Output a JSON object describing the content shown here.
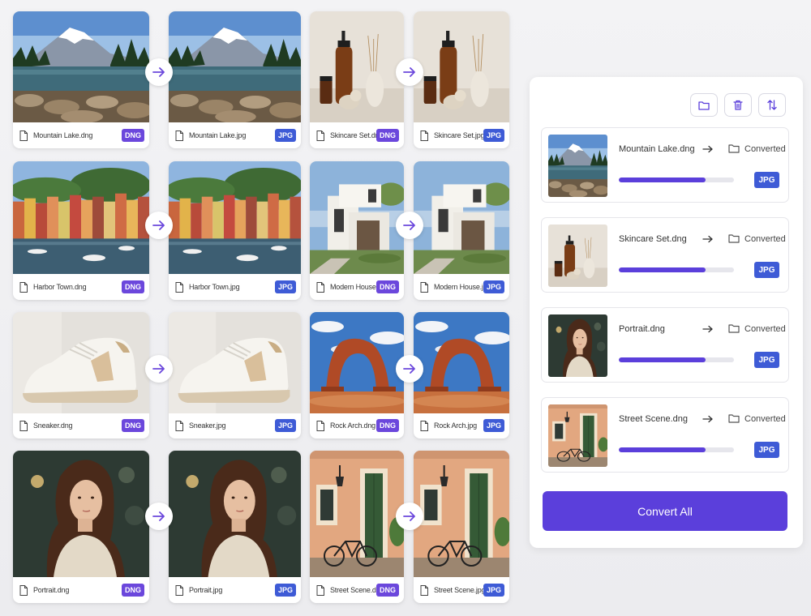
{
  "pairs": [
    {
      "source": "Mountain Lake.dng",
      "output": "Mountain Lake.jpg"
    },
    {
      "source": "Skincare Set.dng",
      "output": "Skincare Set.jpg"
    },
    {
      "source": "Harbor Town.dng",
      "output": "Harbor Town.jpg"
    },
    {
      "source": "Modern House.dng",
      "output": "Modern House.jpg"
    },
    {
      "source": "Sneaker.dng",
      "output": "Sneaker.jpg"
    },
    {
      "source": "Rock Arch.dng",
      "output": "Rock Arch.jpg"
    },
    {
      "source": "Portrait.dng",
      "output": "Portrait.jpg"
    },
    {
      "source": "Street Scene.dng",
      "output": "Street Scene.jpg"
    }
  ],
  "badges": {
    "source": "DNG",
    "output": "JPG"
  },
  "toolbar": {
    "icons": [
      "folder-icon",
      "trash-icon",
      "sort-icon"
    ]
  },
  "queue": [
    {
      "name": "Mountain Lake.dng",
      "status": "Converted",
      "format": "JPG",
      "progress": 0.75
    },
    {
      "name": "Skincare Set.dng",
      "status": "Converted",
      "format": "JPG",
      "progress": 0.75
    },
    {
      "name": "Portrait.dng",
      "status": "Converted",
      "format": "JPG",
      "progress": 0.75
    },
    {
      "name": "Street Scene.dng",
      "status": "Converted",
      "format": "JPG",
      "progress": 0.75
    }
  ],
  "convert_all_label": "Convert All",
  "colors": {
    "accent": "#5b3fdb",
    "dng_badge": "#6b47dc",
    "jpg_badge": "#3e5bd6"
  }
}
